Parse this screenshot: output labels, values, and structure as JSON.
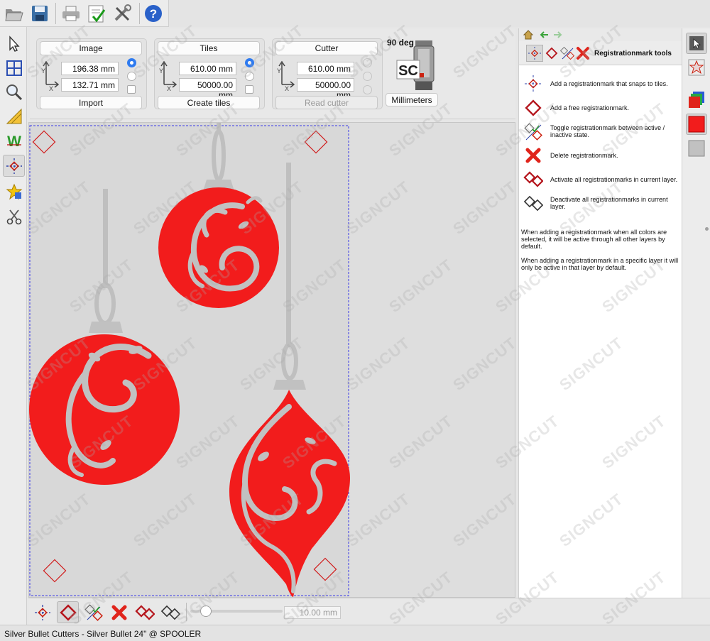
{
  "window": {
    "status_text": "Silver Bullet Cutters - Silver Bullet 24\" @ SPOOLER"
  },
  "top_toolbar": {
    "buttons": [
      {
        "name": "open-folder-icon"
      },
      {
        "name": "save-icon"
      },
      {
        "name": "print-icon"
      },
      {
        "name": "checklist-icon"
      },
      {
        "name": "tools-icon"
      },
      {
        "name": "help-icon"
      }
    ]
  },
  "left_toolbar": {
    "tools": [
      "select-arrow-icon",
      "grid-icon",
      "zoom-icon",
      "ruler-icon",
      "weed-w-icon",
      "registration-mark-icon",
      "star-shape-icon",
      "scissors-icon"
    ]
  },
  "image_group": {
    "header": "Image",
    "x_value": "196.38 mm",
    "y_value": "132.71 mm",
    "footer": "Import"
  },
  "tiles_group": {
    "header": "Tiles",
    "x_value": "610.00 mm",
    "y_value": "50000.00 mm",
    "footer": "Create tiles"
  },
  "cutter_group": {
    "header": "Cutter",
    "x_value": "610.00 mm",
    "y_value": "50000.00 mm",
    "footer": "Read cutter"
  },
  "rotation": {
    "label": "90 deg"
  },
  "logo": {
    "text": "SC"
  },
  "units": {
    "label": "Millimeters"
  },
  "zoom": {
    "field_value": "10.00 mm",
    "slider_fraction": 0.12
  },
  "reg_panel": {
    "title": "Registrationmark tools",
    "items": [
      {
        "icon": "snap-registration-icon",
        "text": "Add a registrationmark that snaps to tiles."
      },
      {
        "icon": "free-registration-icon",
        "text": "Add a free registrationmark."
      },
      {
        "icon": "toggle-registration-icon",
        "text": "Toggle registrationmark between active / inactive state."
      },
      {
        "icon": "delete-registration-icon",
        "text": "Delete registrationmark."
      },
      {
        "icon": "activate-all-icon",
        "text": "Activate all registrationmarks in current layer."
      },
      {
        "icon": "deactivate-all-icon",
        "text": "Deactivate all registrationmarks in current layer."
      }
    ],
    "note1": "When adding a registrationmark when all colors are selected, it will be active through all other layers by default.",
    "note2": "When adding a registrationmark in a specific layer it will only be active in that layer by default."
  },
  "watermark": {
    "text": "SIGNCUT"
  },
  "colors": {
    "ornament_red": "#f21c1c",
    "ornament_gray": "#c1c1c1",
    "reg_mark_red": "#d11a1a",
    "tile_border_blue": "#3a3ae8",
    "accent_blue": "#2f7bf0"
  }
}
